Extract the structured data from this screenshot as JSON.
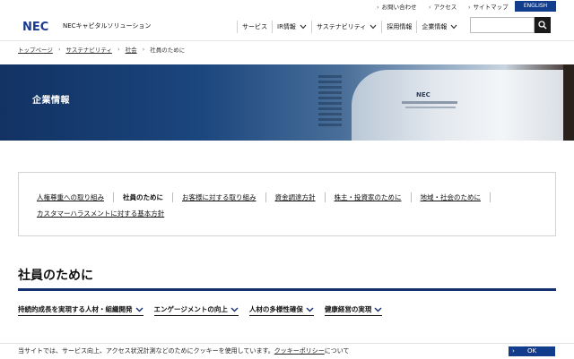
{
  "utility": {
    "links": [
      {
        "label": "お問い合わせ"
      },
      {
        "label": "アクセス"
      },
      {
        "label": "サイトマップ"
      }
    ],
    "english_label": "ENGLISH"
  },
  "header": {
    "logo_text": "NEC",
    "company_name": "NECキャピタルソリューション",
    "nav": [
      {
        "label": "サービス",
        "dropdown": false
      },
      {
        "label": "IR情報",
        "dropdown": true
      },
      {
        "label": "サステナビリティ",
        "dropdown": true
      },
      {
        "label": "採用情報",
        "dropdown": false
      },
      {
        "label": "企業情報",
        "dropdown": true
      }
    ],
    "search": {
      "placeholder": "",
      "value": ""
    }
  },
  "breadcrumb": [
    {
      "label": "トップページ"
    },
    {
      "label": "サステナビリティ"
    },
    {
      "label": "社会"
    },
    {
      "label": "社員のために"
    }
  ],
  "hero": {
    "title": "企業情報",
    "wall_logo": "NEC"
  },
  "subnav": {
    "row1": [
      {
        "label": "人権尊重への取り組み"
      },
      {
        "label": "社員のために"
      },
      {
        "label": "お客様に対する取り組み"
      },
      {
        "label": "資金調達方針"
      },
      {
        "label": "株主・投資家のために"
      },
      {
        "label": "地域・社会のために"
      }
    ],
    "row2": [
      {
        "label": "カスタマーハラスメントに対する基本方針"
      }
    ]
  },
  "page": {
    "heading": "社員のために",
    "anchors": [
      {
        "label": "持続的成長を実現する人材・組織開発"
      },
      {
        "label": "エンゲージメントの向上"
      },
      {
        "label": "人材の多様性確保"
      },
      {
        "label": "健康経営の実現"
      }
    ]
  },
  "cookie": {
    "message_pre": "当サイトでは、サービス向上、アクセス状況計測などのためにクッキーを使用しています。",
    "policy_link": "クッキーポリシー",
    "message_post": "について",
    "ok_label": "OK"
  },
  "colors": {
    "brand_blue": "#123c8c",
    "heading_rule": "#14306e",
    "logo_blue": "#1a3a8f"
  }
}
